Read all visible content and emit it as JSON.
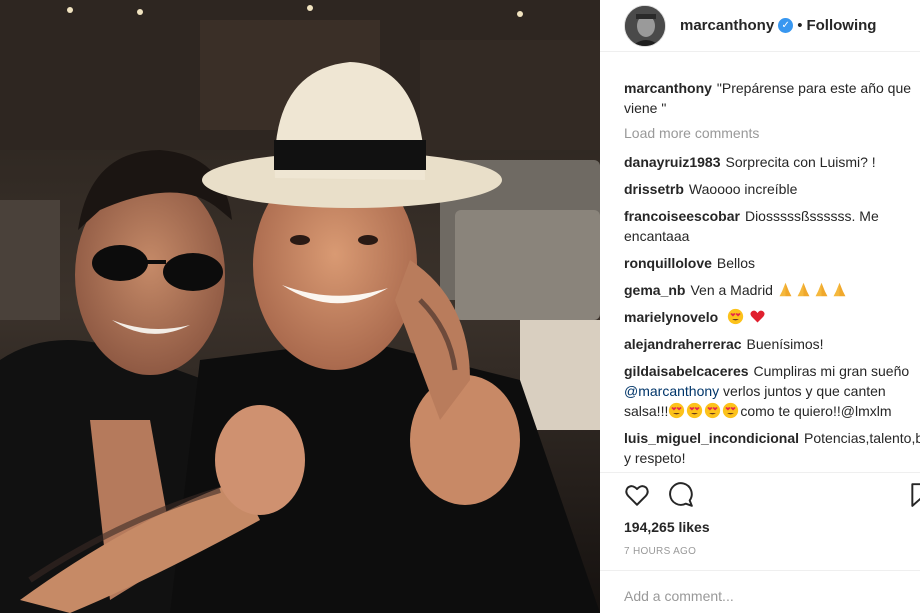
{
  "post": {
    "username": "marcanthony",
    "verified_symbol": "✓",
    "separator": "•",
    "follow_status": "Following"
  },
  "caption": {
    "username": "marcanthony",
    "text": "\"Prepárense para este año que viene \""
  },
  "load_more": "Load more comments",
  "comments": [
    {
      "user": "danayruiz1983",
      "text": "Sorprecita con Luismi? !"
    },
    {
      "user": "drissetrb",
      "text": "Waoooo increíble"
    },
    {
      "user": "francoiseescobar",
      "text": "Diosssssßssssss. Me encantaaa"
    },
    {
      "user": "ronquillolove",
      "text": "Bellos"
    },
    {
      "user": "gema_nb",
      "text": "Ven a Madrid"
    },
    {
      "user": "marielynovelo",
      "text": ""
    },
    {
      "user": "alejandraherrerac",
      "text": "Buenísimos!"
    },
    {
      "user": "gildaisabelcaceres",
      "text_before": "Cumpliras mi gran sueño",
      "mention": "@marcanthony",
      "text_after": "verlos juntos y que canten salsa!!!",
      "text_end": "como te quiero!!@lmxlm"
    },
    {
      "user": "luis_miguel_incondicional",
      "text": "Potencias,talento,belleza y respeto!"
    }
  ],
  "likes": "194,265 likes",
  "time": "7 HOURS AGO",
  "add_comment_placeholder": "Add a comment...",
  "icons": {
    "like": "heart-icon",
    "comment": "comment-icon",
    "save": "bookmark-icon",
    "pray": "praying-hands-emoji",
    "heart_eyes": "heart-eyes-emoji",
    "red_heart": "red-heart-emoji"
  },
  "colors": {
    "verified": "#3897f0",
    "muted": "#999999",
    "text": "#262626",
    "mention": "#003569"
  }
}
